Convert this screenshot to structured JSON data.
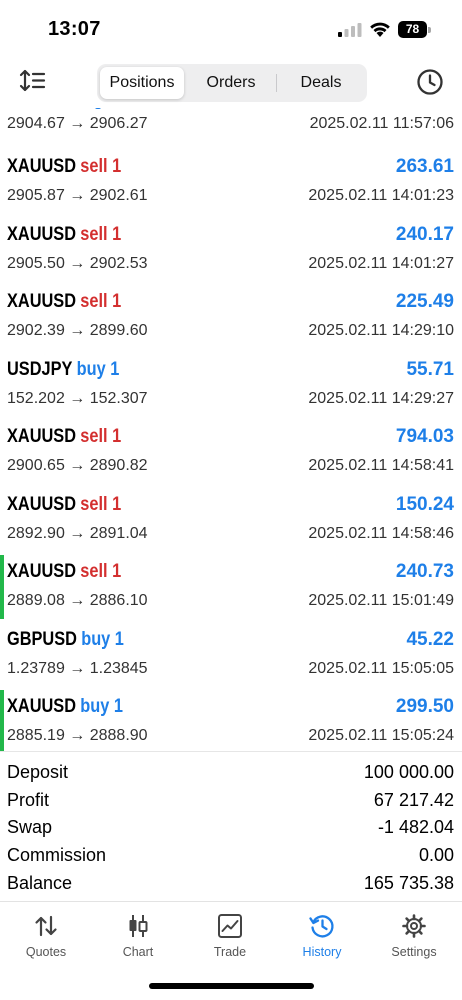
{
  "status": {
    "time": "13:07",
    "battery": "78"
  },
  "header": {
    "tabs": [
      "Positions",
      "Orders",
      "Deals"
    ],
    "active_tab": "Positions"
  },
  "deals": {
    "partial_first": {
      "prices": "2904.67 → 2906.27",
      "time": "2025.02.11 11:57:06"
    },
    "rows": [
      {
        "symbol": "XAUUSD",
        "side": "sell 1",
        "type": "sell",
        "profit": "263.61",
        "prices": "2905.87 → 2902.61",
        "time": "2025.02.11 14:01:23",
        "marked": false
      },
      {
        "symbol": "XAUUSD",
        "side": "sell 1",
        "type": "sell",
        "profit": "240.17",
        "prices": "2905.50 → 2902.53",
        "time": "2025.02.11 14:01:27",
        "marked": false
      },
      {
        "symbol": "XAUUSD",
        "side": "sell 1",
        "type": "sell",
        "profit": "225.49",
        "prices": "2902.39 → 2899.60",
        "time": "2025.02.11 14:29:10",
        "marked": false
      },
      {
        "symbol": "USDJPY",
        "side": "buy 1",
        "type": "buy",
        "profit": "55.71",
        "prices": "152.202 → 152.307",
        "time": "2025.02.11 14:29:27",
        "marked": false
      },
      {
        "symbol": "XAUUSD",
        "side": "sell 1",
        "type": "sell",
        "profit": "794.03",
        "prices": "2900.65 → 2890.82",
        "time": "2025.02.11 14:58:41",
        "marked": false
      },
      {
        "symbol": "XAUUSD",
        "side": "sell 1",
        "type": "sell",
        "profit": "150.24",
        "prices": "2892.90 → 2891.04",
        "time": "2025.02.11 14:58:46",
        "marked": false
      },
      {
        "symbol": "XAUUSD",
        "side": "sell 1",
        "type": "sell",
        "profit": "240.73",
        "prices": "2889.08 → 2886.10",
        "time": "2025.02.11 15:01:49",
        "marked": true
      },
      {
        "symbol": "GBPUSD",
        "side": "buy 1",
        "type": "buy",
        "profit": "45.22",
        "prices": "1.23789 → 1.23845",
        "time": "2025.02.11 15:05:05",
        "marked": false
      },
      {
        "symbol": "XAUUSD",
        "side": "buy 1",
        "type": "buy",
        "profit": "299.50",
        "prices": "2885.19 → 2888.90",
        "time": "2025.02.11 15:05:24",
        "marked": true
      }
    ]
  },
  "summary": {
    "deposit_label": "Deposit",
    "deposit_value": "100 000.00",
    "profit_label": "Profit",
    "profit_value": "67 217.42",
    "swap_label": "Swap",
    "swap_value": "-1 482.04",
    "commission_label": "Commission",
    "commission_value": "0.00",
    "balance_label": "Balance",
    "balance_value": "165 735.38"
  },
  "tabbar": {
    "items": [
      "Quotes",
      "Chart",
      "Trade",
      "History",
      "Settings"
    ],
    "active": "History"
  },
  "colors": {
    "accent": "#1e7fe8",
    "sell": "#d32f2f",
    "marker": "#22b84a"
  },
  "icons": {
    "sort": "sort-icon",
    "history_clock": "clock-icon",
    "quotes": "arrows-updown-icon",
    "chart": "candlestick-icon",
    "trade": "trade-chart-icon",
    "history": "history-icon",
    "settings": "gear-icon"
  }
}
